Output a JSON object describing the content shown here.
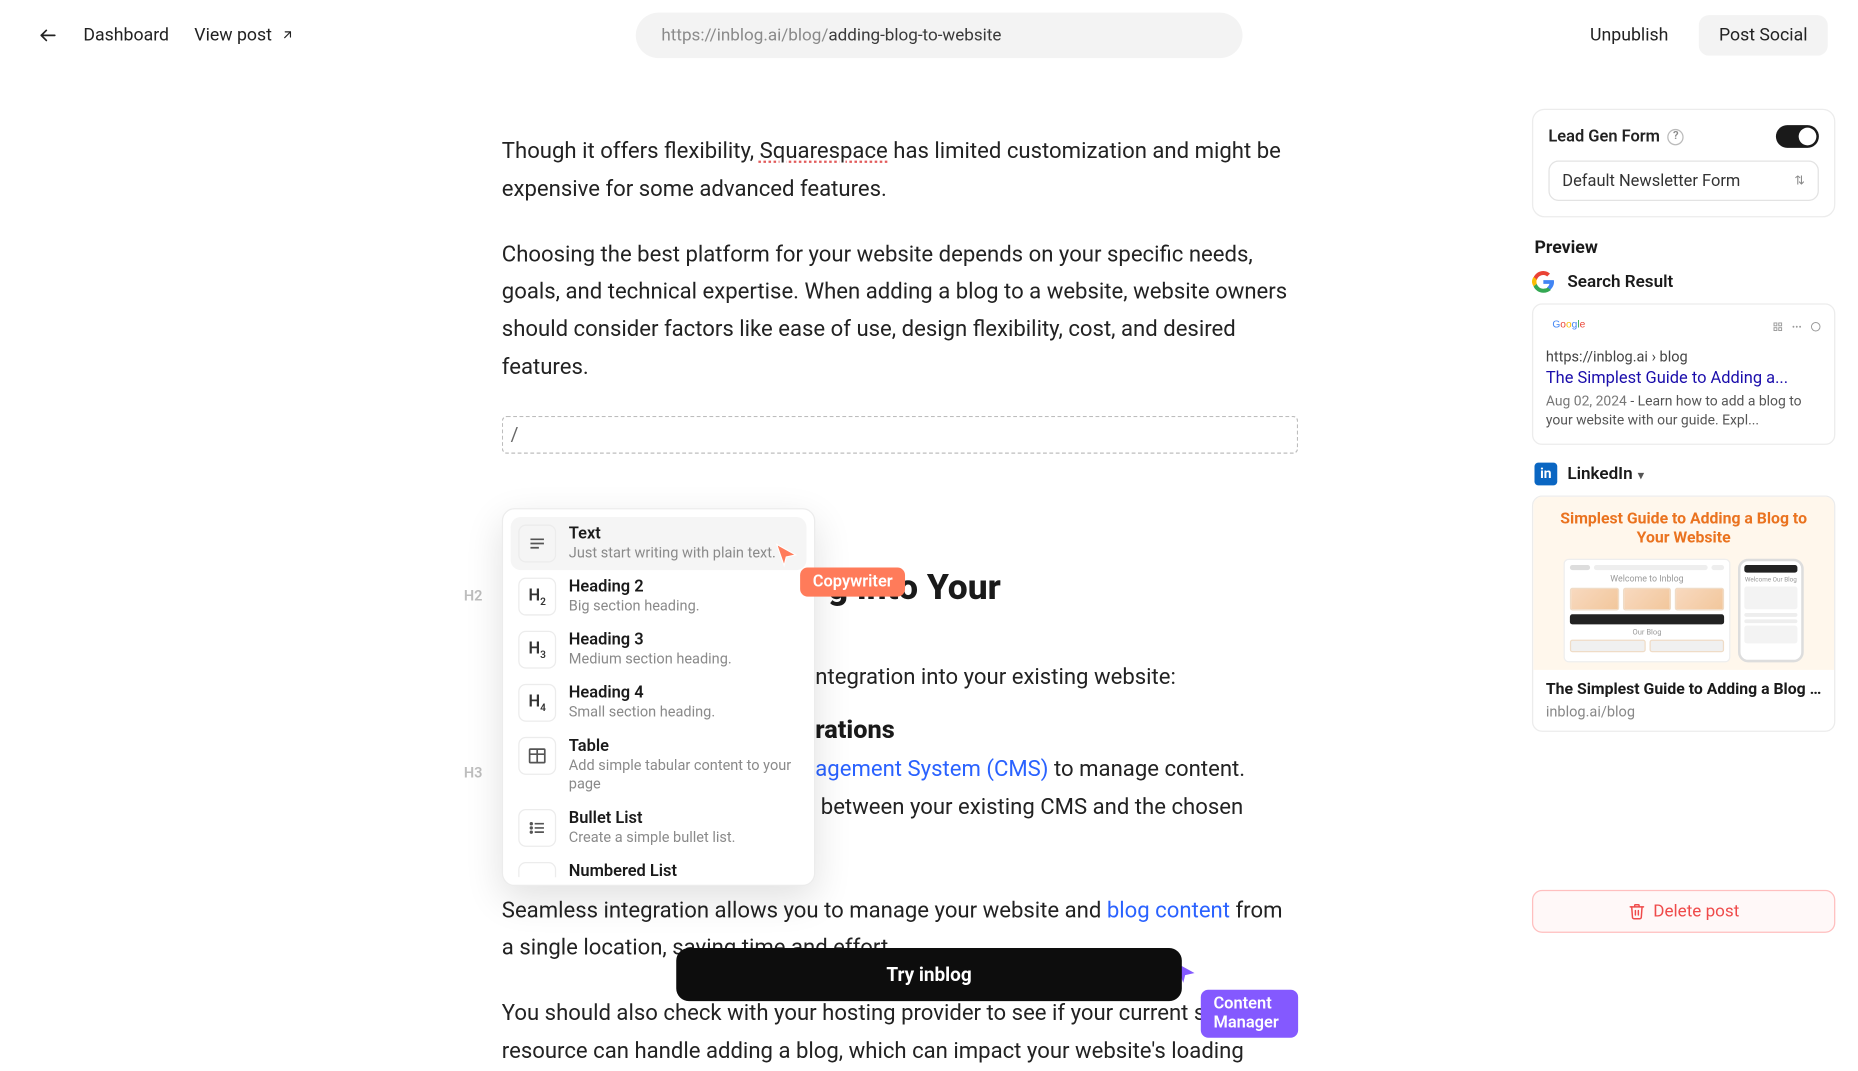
{
  "topbar": {
    "back_label": "",
    "dashboard": "Dashboard",
    "view_post": "View post",
    "url_prefix": "https://inblog.ai/blog/",
    "url_slug": "adding-blog-to-website",
    "unpublish": "Unpublish",
    "post_social": "Post Social"
  },
  "editor": {
    "para1_a": "Though it offers flexibility, ",
    "para1_sq": "Squarespace",
    "para1_b": " has limited customization and might be expensive for some advanced features.",
    "para2": "Choosing the best platform for your website depends on your specific needs, goals, and technical expertise. When adding a blog to a website, website owners should consider factors like ease of use, design flexibility, cost, and desired features.",
    "slash_value": "/",
    "gutter_h2": "H2",
    "gutter_h3": "H3",
    "h2_a": "g into Your",
    "body_integration": "ntegration into your existing website:",
    "h3_a": "rations",
    "body_cms_a": "agement System (CMS)",
    "body_cms_b": " to manage content.",
    "body_cms_c": " between your existing CMS and the chosen blogging platform.",
    "body_seamless_a": "Seamless integration allows you to manage your website and ",
    "body_seamless_link": "blog content",
    "body_seamless_b": " from a single location, saving time and effort.",
    "body_hosting": "You should also check with your hosting provider to see if your current server resource can handle adding a blog, which can impact your website's loading"
  },
  "slash_menu": {
    "items": [
      {
        "icon": "≣",
        "title": "Text",
        "sub": "Just start writing with plain text."
      },
      {
        "icon": "H₂",
        "title": "Heading 2",
        "sub": "Big section heading."
      },
      {
        "icon": "H₃",
        "title": "Heading 3",
        "sub": "Medium section heading."
      },
      {
        "icon": "H₄",
        "title": "Heading 4",
        "sub": "Small section heading."
      },
      {
        "icon": "▦",
        "title": "Table",
        "sub": "Add simple tabular content to your page"
      },
      {
        "icon": "≡",
        "title": "Bullet List",
        "sub": "Create a simple bullet list."
      },
      {
        "icon": "≡",
        "title": "Numbered List",
        "sub": ""
      }
    ]
  },
  "cursors": {
    "copywriter": "Copywriter",
    "content_manager": "Content Manager"
  },
  "sidebar": {
    "leadgen_label": "Lead Gen Form",
    "leadgen_toggle": true,
    "form_select": "Default Newsletter Form",
    "preview_label": "Preview",
    "search_result_label": "Search Result",
    "sr_url": "https://inblog.ai › blog",
    "sr_title": "The Simplest Guide to Adding a...",
    "sr_date": "Aug 02, 2024",
    "sr_desc": " - Learn how to add a blog to your website with our guide. Expl...",
    "linkedin_label": "LinkedIn",
    "li_headline": "Simplest Guide to Adding a Blog to Your Website",
    "li_welcome": "",
    "li_title": "The Simplest Guide to Adding a Blog to...",
    "li_domain": "inblog.ai/blog",
    "delete_label": "Delete post"
  },
  "cta": {
    "label": "Try inblog"
  }
}
